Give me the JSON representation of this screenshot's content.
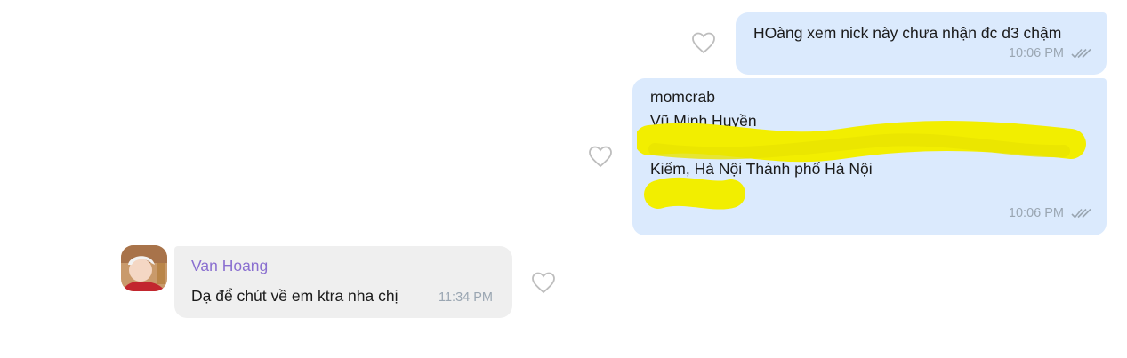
{
  "messages": {
    "m1": {
      "text": "HOàng xem nick này chưa nhận đc d3 chậm",
      "time": "10:06 PM"
    },
    "m2": {
      "lines": [
        "momcrab",
        "Vũ Minh Huyền",
        "",
        "Kiếm, Hà Nội Thành phố Hà Nội"
      ],
      "time": "10:06 PM"
    },
    "m3": {
      "sender": "Van Hoang",
      "text": "Dạ để chút về em ktra nha chị",
      "time": "11:34 PM"
    }
  },
  "icons": {
    "like": "heart-outline-icon",
    "delivered": "double-check-icon"
  },
  "colors": {
    "outgoing_bubble": "#dbeafd",
    "incoming_bubble": "#efefef",
    "sender_name": "#8a6fd0",
    "redaction": "#f2ee00"
  }
}
